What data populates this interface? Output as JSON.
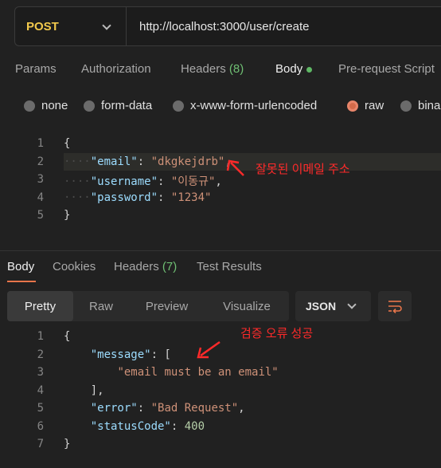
{
  "request": {
    "method": "POST",
    "url": "http://localhost:3000/user/create"
  },
  "request_tabs": [
    {
      "label": "Params",
      "count": ""
    },
    {
      "label": "Authorization",
      "count": ""
    },
    {
      "label": "Headers",
      "count": "(8)"
    },
    {
      "label": "Body",
      "count": ""
    },
    {
      "label": "Pre-request Script",
      "count": ""
    }
  ],
  "body_modes": [
    "none",
    "form-data",
    "x-www-form-urlencoded",
    "raw",
    "bina"
  ],
  "selected_body_mode": "raw",
  "request_body": {
    "line_numbers": [
      "1",
      "2",
      "3",
      "4",
      "5"
    ],
    "email_key": "\"email\"",
    "email_value": "\"dkgkejdrb\"",
    "username_key": "\"username\"",
    "username_value": "\"이동규\"",
    "password_key": "\"password\"",
    "password_value": "\"1234\""
  },
  "annotations": {
    "request": "잘못된 이메일 주소",
    "response": "검증 오류 성공"
  },
  "response_tabs": [
    {
      "label": "Body",
      "count": ""
    },
    {
      "label": "Cookies",
      "count": ""
    },
    {
      "label": "Headers",
      "count": "(7)"
    },
    {
      "label": "Test Results",
      "count": ""
    }
  ],
  "view_modes": [
    "Pretty",
    "Raw",
    "Preview",
    "Visualize"
  ],
  "format": "JSON",
  "response_body": {
    "line_numbers": [
      "1",
      "2",
      "3",
      "4",
      "5",
      "6",
      "7"
    ],
    "message_key": "\"message\"",
    "message_item": "\"email must be an email\"",
    "error_key": "\"error\"",
    "error_value": "\"Bad Request\"",
    "status_key": "\"statusCode\"",
    "status_value": "400"
  },
  "colors": {
    "method": "#f2c94c",
    "accent": "#e8754a",
    "annotation": "#ff2a2a"
  }
}
